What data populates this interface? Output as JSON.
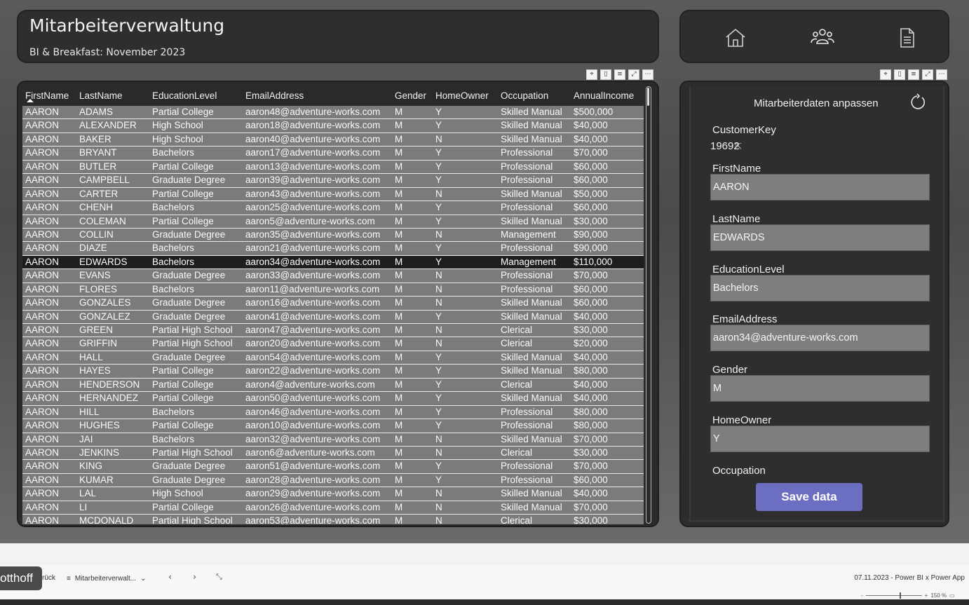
{
  "header": {
    "title": "Mitarbeiterverwaltung",
    "subtitle": "BI & Breakfast: November 2023"
  },
  "nav": {
    "icons": [
      "home-icon",
      "users-icon",
      "document-icon"
    ]
  },
  "visual_header_icons": [
    "pin-icon",
    "copy-icon",
    "filter-icon",
    "focus-icon",
    "more-icon"
  ],
  "table": {
    "columns": [
      "FirstName",
      "LastName",
      "EducationLevel",
      "EmailAddress",
      "Gender",
      "HomeOwner",
      "Occupation",
      "AnnualIncome"
    ],
    "sort_column": "FirstName",
    "selected_row_index": 11,
    "rows": [
      [
        "AARON",
        "ADAMS",
        "Partial College",
        "aaron48@adventure-works.com",
        "M",
        "Y",
        "Skilled Manual",
        "$500,000"
      ],
      [
        "AARON",
        "ALEXANDER",
        "High School",
        "aaron18@adventure-works.com",
        "M",
        "Y",
        "Skilled Manual",
        "$40,000"
      ],
      [
        "AARON",
        "BAKER",
        "High School",
        "aaron40@adventure-works.com",
        "M",
        "N",
        "Skilled Manual",
        "$40,000"
      ],
      [
        "AARON",
        "BRYANT",
        "Bachelors",
        "aaron17@adventure-works.com",
        "M",
        "Y",
        "Professional",
        "$70,000"
      ],
      [
        "AARON",
        "BUTLER",
        "Partial College",
        "aaron13@adventure-works.com",
        "M",
        "Y",
        "Professional",
        "$60,000"
      ],
      [
        "AARON",
        "CAMPBELL",
        "Graduate Degree",
        "aaron39@adventure-works.com",
        "M",
        "Y",
        "Professional",
        "$60,000"
      ],
      [
        "AARON",
        "CARTER",
        "Partial College",
        "aaron43@adventure-works.com",
        "M",
        "N",
        "Skilled Manual",
        "$50,000"
      ],
      [
        "AARON",
        "CHENH",
        "Bachelors",
        "aaron25@adventure-works.com",
        "M",
        "Y",
        "Professional",
        "$60,000"
      ],
      [
        "AARON",
        "COLEMAN",
        "Partial College",
        "aaron5@adventure-works.com",
        "M",
        "Y",
        "Skilled Manual",
        "$30,000"
      ],
      [
        "AARON",
        "COLLIN",
        "Graduate Degree",
        "aaron35@adventure-works.com",
        "M",
        "N",
        "Management",
        "$90,000"
      ],
      [
        "AARON",
        "DIAZE",
        "Bachelors",
        "aaron21@adventure-works.com",
        "M",
        "Y",
        "Professional",
        "$90,000"
      ],
      [
        "AARON",
        "EDWARDS",
        "Bachelors",
        "aaron34@adventure-works.com",
        "M",
        "Y",
        "Management",
        "$110,000"
      ],
      [
        "AARON",
        "EVANS",
        "Graduate Degree",
        "aaron33@adventure-works.com",
        "M",
        "N",
        "Professional",
        "$70,000"
      ],
      [
        "AARON",
        "FLORES",
        "Bachelors",
        "aaron11@adventure-works.com",
        "M",
        "N",
        "Professional",
        "$60,000"
      ],
      [
        "AARON",
        "GONZALES",
        "Graduate Degree",
        "aaron16@adventure-works.com",
        "M",
        "N",
        "Skilled Manual",
        "$60,000"
      ],
      [
        "AARON",
        "GONZALEZ",
        "Graduate Degree",
        "aaron41@adventure-works.com",
        "M",
        "Y",
        "Skilled Manual",
        "$40,000"
      ],
      [
        "AARON",
        "GREEN",
        "Partial High School",
        "aaron47@adventure-works.com",
        "M",
        "N",
        "Clerical",
        "$30,000"
      ],
      [
        "AARON",
        "GRIFFIN",
        "Partial High School",
        "aaron20@adventure-works.com",
        "M",
        "N",
        "Clerical",
        "$20,000"
      ],
      [
        "AARON",
        "HALL",
        "Graduate Degree",
        "aaron54@adventure-works.com",
        "M",
        "Y",
        "Skilled Manual",
        "$40,000"
      ],
      [
        "AARON",
        "HAYES",
        "Partial College",
        "aaron22@adventure-works.com",
        "M",
        "Y",
        "Skilled Manual",
        "$80,000"
      ],
      [
        "AARON",
        "HENDERSON",
        "Partial College",
        "aaron4@adventure-works.com",
        "M",
        "Y",
        "Clerical",
        "$40,000"
      ],
      [
        "AARON",
        "HERNANDEZ",
        "Partial College",
        "aaron50@adventure-works.com",
        "M",
        "Y",
        "Skilled Manual",
        "$40,000"
      ],
      [
        "AARON",
        "HILL",
        "Bachelors",
        "aaron46@adventure-works.com",
        "M",
        "Y",
        "Professional",
        "$80,000"
      ],
      [
        "AARON",
        "HUGHES",
        "Partial College",
        "aaron10@adventure-works.com",
        "M",
        "Y",
        "Professional",
        "$80,000"
      ],
      [
        "AARON",
        "JAI",
        "Bachelors",
        "aaron32@adventure-works.com",
        "M",
        "N",
        "Skilled Manual",
        "$70,000"
      ],
      [
        "AARON",
        "JENKINS",
        "Partial High School",
        "aaron6@adventure-works.com",
        "M",
        "N",
        "Clerical",
        "$30,000"
      ],
      [
        "AARON",
        "KING",
        "Graduate Degree",
        "aaron51@adventure-works.com",
        "M",
        "Y",
        "Professional",
        "$70,000"
      ],
      [
        "AARON",
        "KUMAR",
        "Graduate Degree",
        "aaron28@adventure-works.com",
        "M",
        "Y",
        "Professional",
        "$60,000"
      ],
      [
        "AARON",
        "LAL",
        "High School",
        "aaron29@adventure-works.com",
        "M",
        "N",
        "Skilled Manual",
        "$40,000"
      ],
      [
        "AARON",
        "LI",
        "Partial College",
        "aaron26@adventure-works.com",
        "M",
        "N",
        "Skilled Manual",
        "$70,000"
      ],
      [
        "AARON",
        "MCDONALD",
        "Partial High School",
        "aaron53@adventure-works.com",
        "M",
        "N",
        "Clerical",
        "$30,000"
      ]
    ]
  },
  "form": {
    "title": "Mitarbeiterdaten anpassen",
    "customerkey_label": "CustomerKey",
    "customerkey_value": "19692",
    "fields": [
      {
        "label": "FirstName",
        "value": "AARON"
      },
      {
        "label": "LastName",
        "value": "EDWARDS"
      },
      {
        "label": "EducationLevel",
        "value": "Bachelors"
      },
      {
        "label": "EmailAddress",
        "value": "aaron34@adventure-works.com"
      },
      {
        "label": "Gender",
        "value": "M"
      },
      {
        "label": "HomeOwner",
        "value": "Y"
      }
    ],
    "occupation_label": "Occupation",
    "save_label": "Save data"
  },
  "bottom": {
    "presenter": "otthoff",
    "back": "rück",
    "page_tab": "Mitarbeiterverwalt...",
    "status": "07.11.2023 - Power BI x Power App",
    "zoom_label": "150 %"
  },
  "colors": {
    "accent": "#6c6fc1",
    "row_bg": "#7b7b7b",
    "selected_row_bg": "#1e1e1e",
    "panel_bg": "#2e2e2e"
  }
}
